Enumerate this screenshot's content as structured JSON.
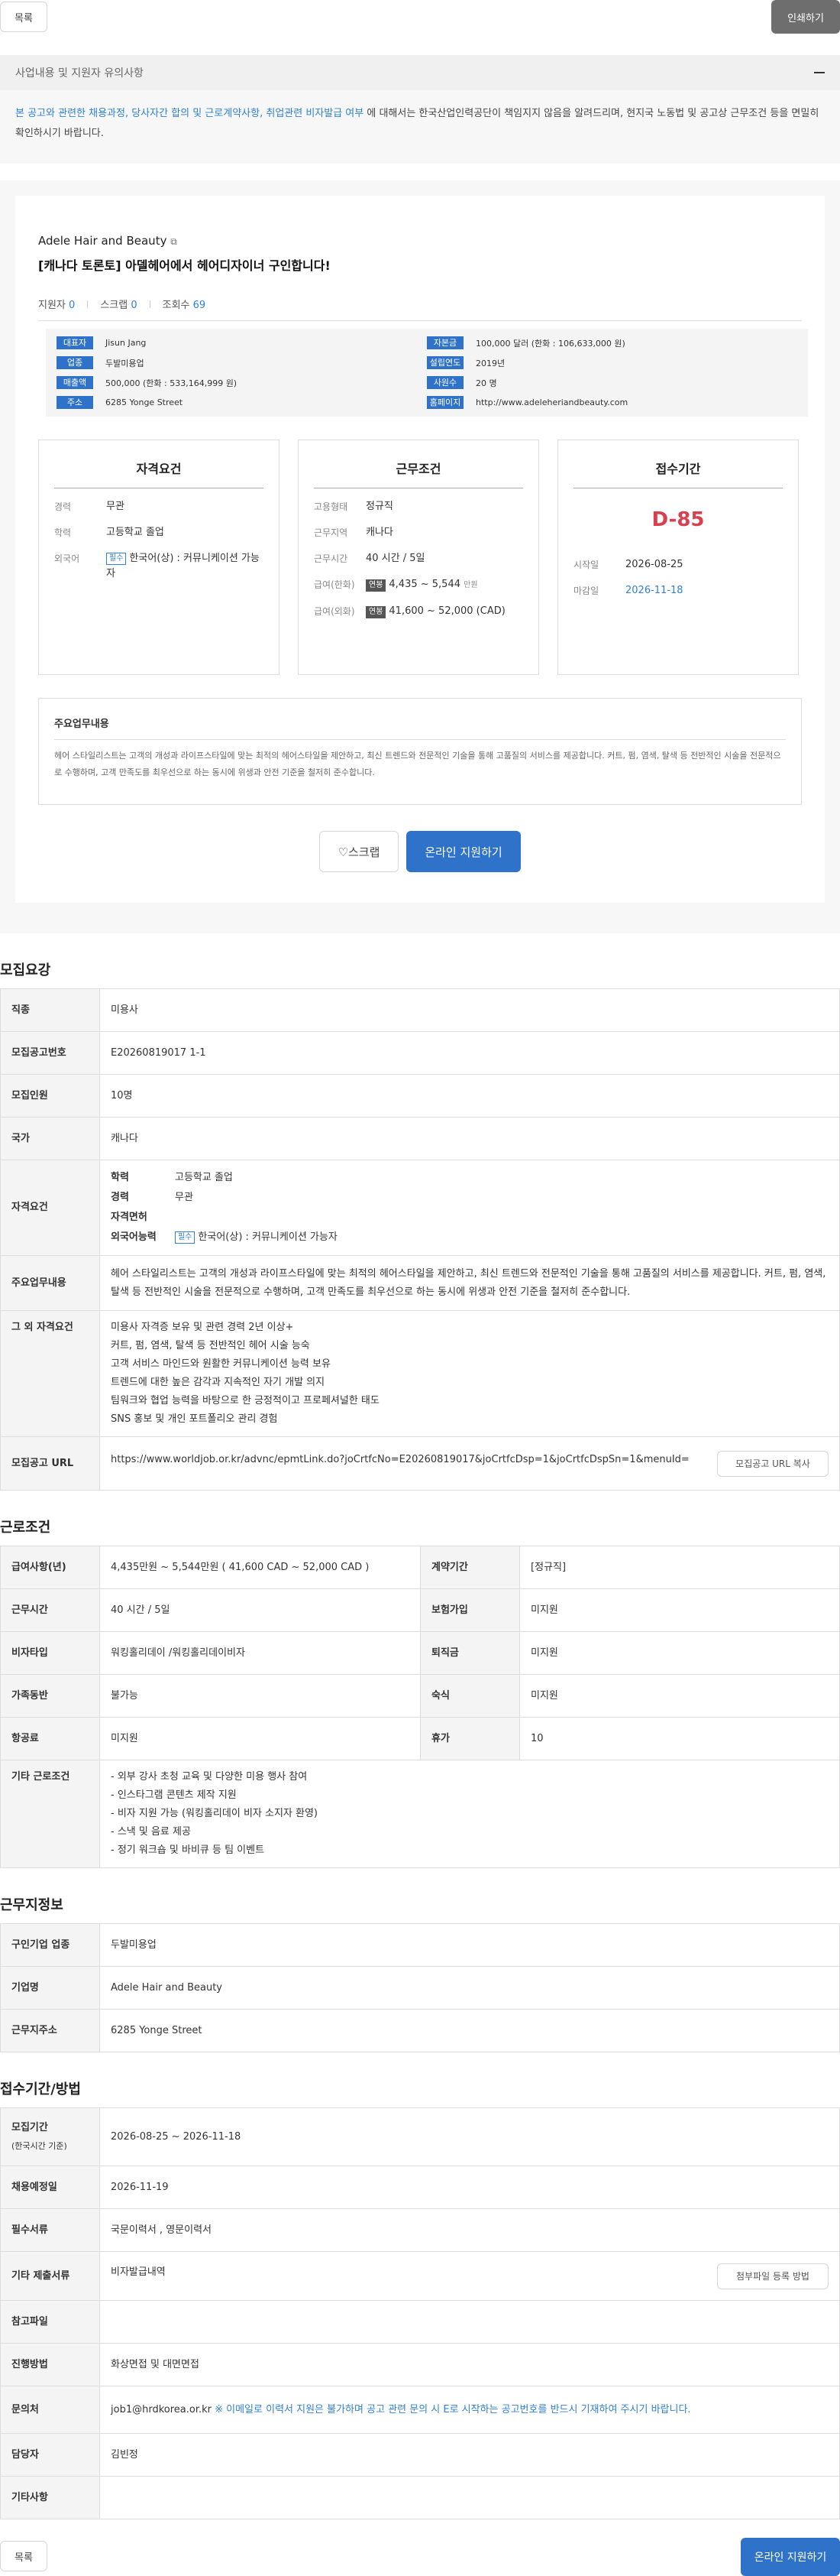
{
  "toolbar": {
    "list_label": "목록",
    "print_label": "인쇄하기"
  },
  "notice": {
    "title": "사업내용 및 지원자 유의사항",
    "blue_text": "본 공고와 관련한 채용과정, 당사자간 합의 및 근로계약사항, 취업관련 비자발급 여부",
    "rest_text": " 에 대해서는 한국산업인력공단이 책임지지 않음을 알려드리며, 현지국 노동법 및 공고상 근무조건 등을 면밀히 확인하시기 바랍니다."
  },
  "summary": {
    "company": "Adele Hair and Beauty",
    "title": "[캐나다 토론토] 아델헤어에서 헤어디자이너 구인합니다!",
    "applicants_label": "지원자",
    "applicants": "0",
    "scraps_label": "스크랩",
    "scraps": "0",
    "views_label": "조회수",
    "views": "69",
    "info": [
      {
        "tag": "대표자",
        "value": "Jisun Jang"
      },
      {
        "tag": "자본금",
        "value": "100,000 달러 (한화 : 106,633,000 원)"
      },
      {
        "tag": "업종",
        "value": "두발미용업"
      },
      {
        "tag": "설립연도",
        "value": "2019년"
      },
      {
        "tag": "매출액",
        "value": "500,000 (한화 : 533,164,999 원)"
      },
      {
        "tag": "사원수",
        "value": "20 명"
      },
      {
        "tag": "주소",
        "value": "6285 Yonge Street"
      },
      {
        "tag": "홈페이지",
        "value": "http://www.adeleheriandbeauty.com"
      }
    ],
    "qual": {
      "title": "자격요건",
      "career_k": "경력",
      "career_v": "무관",
      "edu_k": "학력",
      "edu_v": "고등학교 졸업",
      "lang_k": "외국어",
      "lang_pill": "필수",
      "lang_v": "한국어(상) : 커뮤니케이션 가능자"
    },
    "work": {
      "title": "근무조건",
      "type_k": "고용형태",
      "type_v": "정규직",
      "region_k": "근무지역",
      "region_v": "캐나다",
      "hours_k": "근무시간",
      "hours_v": "40 시간 / 5일",
      "pay_k": "급여(한화)",
      "pay_tag": "연봉",
      "pay_v": "4,435 ~ 5,544",
      "pay_unit": "만원",
      "payf_k": "급여(외화)",
      "payf_tag": "연봉",
      "payf_v": "41,600 ~ 52,000 (CAD)"
    },
    "period": {
      "title": "접수기간",
      "dday": "D-85",
      "start_k": "시작일",
      "start_v": "2026-08-25",
      "end_k": "마감일",
      "end_v": "2026-11-18"
    },
    "duty_title": "주요업무내용",
    "duty_text": "헤어 스타일리스트는 고객의 개성과 라이프스타일에 맞는 최적의 헤어스타일을 제안하고, 최신 트렌드와 전문적인 기술을 통해 고품질의 서비스를 제공합니다. 커트, 펌, 염색, 탈색 등 전반적인 시술을 전문적으로 수행하며, 고객 만족도를 최우선으로 하는 동시에 위생과 안전 기준을 철저히 준수합니다.",
    "scrap_label": "♡스크랩",
    "apply_label": "온라인 지원하기"
  },
  "recruit": {
    "title": "모집요강",
    "job_k": "직종",
    "job_v": "미용사",
    "no_k": "모집공고번호",
    "no_v": "E20260819017 1-1",
    "count_k": "모집인원",
    "count_v": "10명",
    "country_k": "국가",
    "country_v": "캐나다",
    "qual_k": "자격요건",
    "q_edu_k": "학력",
    "q_edu_v": "고등학교 졸업",
    "q_career_k": "경력",
    "q_career_v": "무관",
    "q_license_k": "자격면허",
    "q_lang_k": "외국어능력",
    "q_lang_pill": "필수",
    "q_lang_v": "한국어(상) : 커뮤니케이션 가능자",
    "duty_k": "주요업무내용",
    "duty_v": "헤어 스타일리스트는 고객의 개성과 라이프스타일에 맞는 최적의 헤어스타일을 제안하고, 최신 트렌드와 전문적인 기술을 통해 고품질의 서비스를 제공합니다. 커트, 펌, 염색, 탈색 등 전반적인 시술을 전문적으로 수행하며, 고객 만족도를 최우선으로 하는 동시에 위생과 안전 기준을 철저히 준수합니다.",
    "etc_k": "그 외 자격요건",
    "etc_lines": [
      "미용사 자격증 보유 및 관련 경력 2년 이상+",
      "커트, 펌, 염색, 탈색 등 전반적인 헤어 시술 능숙",
      "고객 서비스 마인드와 원활한 커뮤니케이션 능력 보유",
      "트렌드에 대한 높은 감각과 지속적인 자기 개발 의지",
      "팀워크와 협업 능력을 바탕으로 한 긍정적이고 프로페셔널한 태도",
      "SNS 홍보 및 개인 포트폴리오 관리 경험"
    ],
    "url_k": "모집공고 URL",
    "url_v": "https://www.worldjob.or.kr/advnc/epmtLink.do?joCrtfcNo=E20260819017&joCrtfcDsp=1&joCrtfcDspSn=1&menuId=",
    "url_btn": "모집공고 URL 복사"
  },
  "labor": {
    "title": "근로조건",
    "salary_k": "급여사항(년)",
    "salary_v": "4,435만원 ~ 5,544만원 ( 41,600 CAD ~ 52,000 CAD )",
    "contract_k": "계약기간",
    "contract_v": "[정규직]",
    "hours_k": "근무시간",
    "hours_v": "40 시간 / 5일",
    "insurance_k": "보험가입",
    "insurance_v": "미지원",
    "visa_k": "비자타입",
    "visa_v": "워킹홀리데이 /워킹홀리데이비자",
    "severance_k": "퇴직금",
    "severance_v": "미지원",
    "family_k": "가족동반",
    "family_v": "불가능",
    "lodging_k": "숙식",
    "lodging_v": "미지원",
    "air_k": "항공료",
    "air_v": "미지원",
    "leave_k": "휴가",
    "leave_v": "10",
    "other_k": "기타 근로조건",
    "other_lines": [
      "- 외부 강사 초청 교육 및 다양한 미용 행사 참여",
      "- 인스타그램 콘텐츠 제작 지원",
      "- 비자 지원 가능 (워킹홀리데이 비자 소지자 환영)",
      "- 스낵 및 음료 제공",
      "- 정기 워크숍 및 바비큐 등 팀 이벤트"
    ]
  },
  "workplace": {
    "title": "근무지정보",
    "industry_k": "구인기업 업종",
    "industry_v": "두발미용업",
    "company_k": "기업명",
    "company_v": "Adele Hair and Beauty",
    "address_k": "근무지주소",
    "address_v": "6285 Yonge Street"
  },
  "apply": {
    "title": "접수기간/방법",
    "period_k": "모집기간",
    "period_sub": "(한국시간 기준)",
    "period_v": "2026-08-25 ~ 2026-11-18",
    "hire_k": "채용예정일",
    "hire_v": "2026-11-19",
    "docs_k": "필수서류",
    "docs_v": "국문이력서 , 영문이력서",
    "etcdocs_k": "기타 제출서류",
    "etcdocs_v": "비자발급내역",
    "etcdocs_btn": "첨부파일 등록 방법",
    "ref_k": "참고파일",
    "ref_v": "",
    "method_k": "진행방법",
    "method_v": "화상면접 및 대면면접",
    "contact_k": "문의처",
    "contact_v": "job1@hrdkorea.or.kr",
    "contact_note": " ※ 이메일로 이력서 지원은 불가하며 공고 관련 문의 시 E로 시작하는 공고번호를 반드시 기재하여 주시기 바랍니다.",
    "manager_k": "담당자",
    "manager_v": "김빈정",
    "misc_k": "기타사항",
    "misc_v": ""
  },
  "footer": {
    "list_label": "목록",
    "apply_label": "온라인 지원하기"
  }
}
